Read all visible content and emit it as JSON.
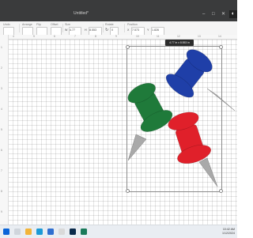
{
  "window": {
    "title": "Untitled*",
    "controls": [
      "–",
      "□",
      "✕"
    ]
  },
  "toolbar": {
    "groups": [
      {
        "label": "Undo",
        "value": ""
      },
      {
        "label": "Arrange",
        "value": ""
      },
      {
        "label": "Flip",
        "value": ""
      },
      {
        "label": "Offset",
        "value": ""
      },
      {
        "label": "Size",
        "w_label": "W",
        "w_value": "4.77",
        "h_label": "H",
        "h_value": "8.553"
      },
      {
        "label": "Rotate",
        "value": "0"
      },
      {
        "label": "Position",
        "x_label": "X",
        "x_value": "7.573",
        "y_label": "Y",
        "y_value": "1.826"
      }
    ]
  },
  "ruler": {
    "h_marks": [
      "4",
      "5",
      "6",
      "7",
      "8",
      "9",
      "10",
      "11",
      "12",
      "13",
      "14"
    ],
    "v_marks": [
      "1",
      "2",
      "3",
      "4",
      "5",
      "6",
      "7",
      "8",
      "9"
    ]
  },
  "selection": {
    "dimension_label": "4.77 in x 8.553 in"
  },
  "pins": [
    {
      "name": "blue-push-pin",
      "color": "#1f3fa8"
    },
    {
      "name": "green-push-pin",
      "color": "#1f7a3a"
    },
    {
      "name": "red-push-pin",
      "color": "#e0202a"
    }
  ],
  "taskbar": {
    "time": "10:42 AM",
    "date": "1/12/2024",
    "apps": [
      "windows-start",
      "search",
      "file-explorer",
      "edge-browser",
      "mail",
      "store",
      "photoshop",
      "design-space"
    ]
  }
}
